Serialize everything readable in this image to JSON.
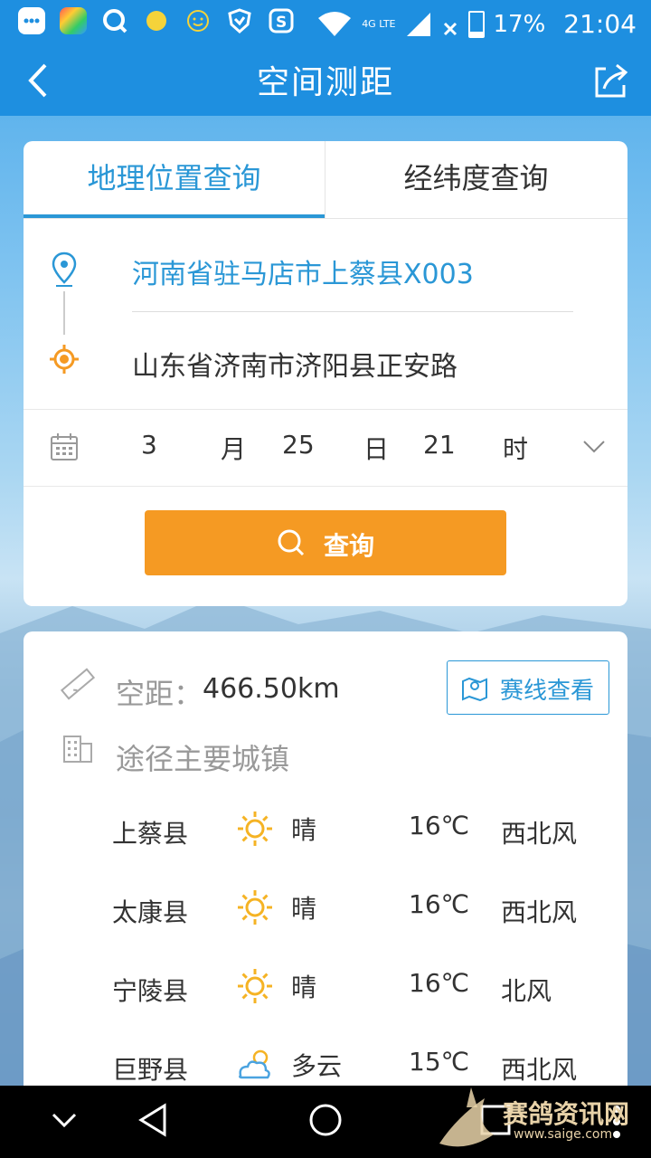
{
  "status_bar": {
    "battery": "17%",
    "battery_level": 0.17,
    "time": "21:04",
    "network": "4G LTE"
  },
  "header": {
    "title": "空间测距",
    "back_icon": "back-arrow-icon",
    "share_icon": "share-icon"
  },
  "tabs": [
    {
      "label": "地理位置查询",
      "active": true
    },
    {
      "label": "经纬度查询",
      "active": false
    }
  ],
  "origin": {
    "text": "河南省驻马店市上蔡县X003",
    "icon": "location-pin-icon"
  },
  "destination": {
    "text": "山东省济南市济阳县正安路",
    "icon": "target-icon"
  },
  "date": {
    "month": "3",
    "month_unit": "月",
    "day": "25",
    "day_unit": "日",
    "hour": "21",
    "hour_unit": "时"
  },
  "search_button": {
    "label": "查询"
  },
  "result": {
    "distance_label": "空距：",
    "distance_value": "466.50km",
    "route_button": "赛线查看",
    "towns_label": "途径主要城镇",
    "towns": [
      {
        "name": "上蔡县",
        "weather": "晴",
        "icon": "sun-icon",
        "temp": "16℃",
        "wind": "西北风"
      },
      {
        "name": "太康县",
        "weather": "晴",
        "icon": "sun-icon",
        "temp": "16℃",
        "wind": "西北风"
      },
      {
        "name": "宁陵县",
        "weather": "晴",
        "icon": "sun-icon",
        "temp": "16℃",
        "wind": "北风"
      },
      {
        "name": "巨野县",
        "weather": "多云",
        "icon": "cloud-sun-icon",
        "temp": "15℃",
        "wind": "西北风"
      }
    ]
  },
  "watermark": {
    "text": "赛鸽资讯网",
    "url": "www.saige.com"
  },
  "colors": {
    "primary": "#1e8fe0",
    "accent": "#2a97d6",
    "button": "#f59a23"
  }
}
